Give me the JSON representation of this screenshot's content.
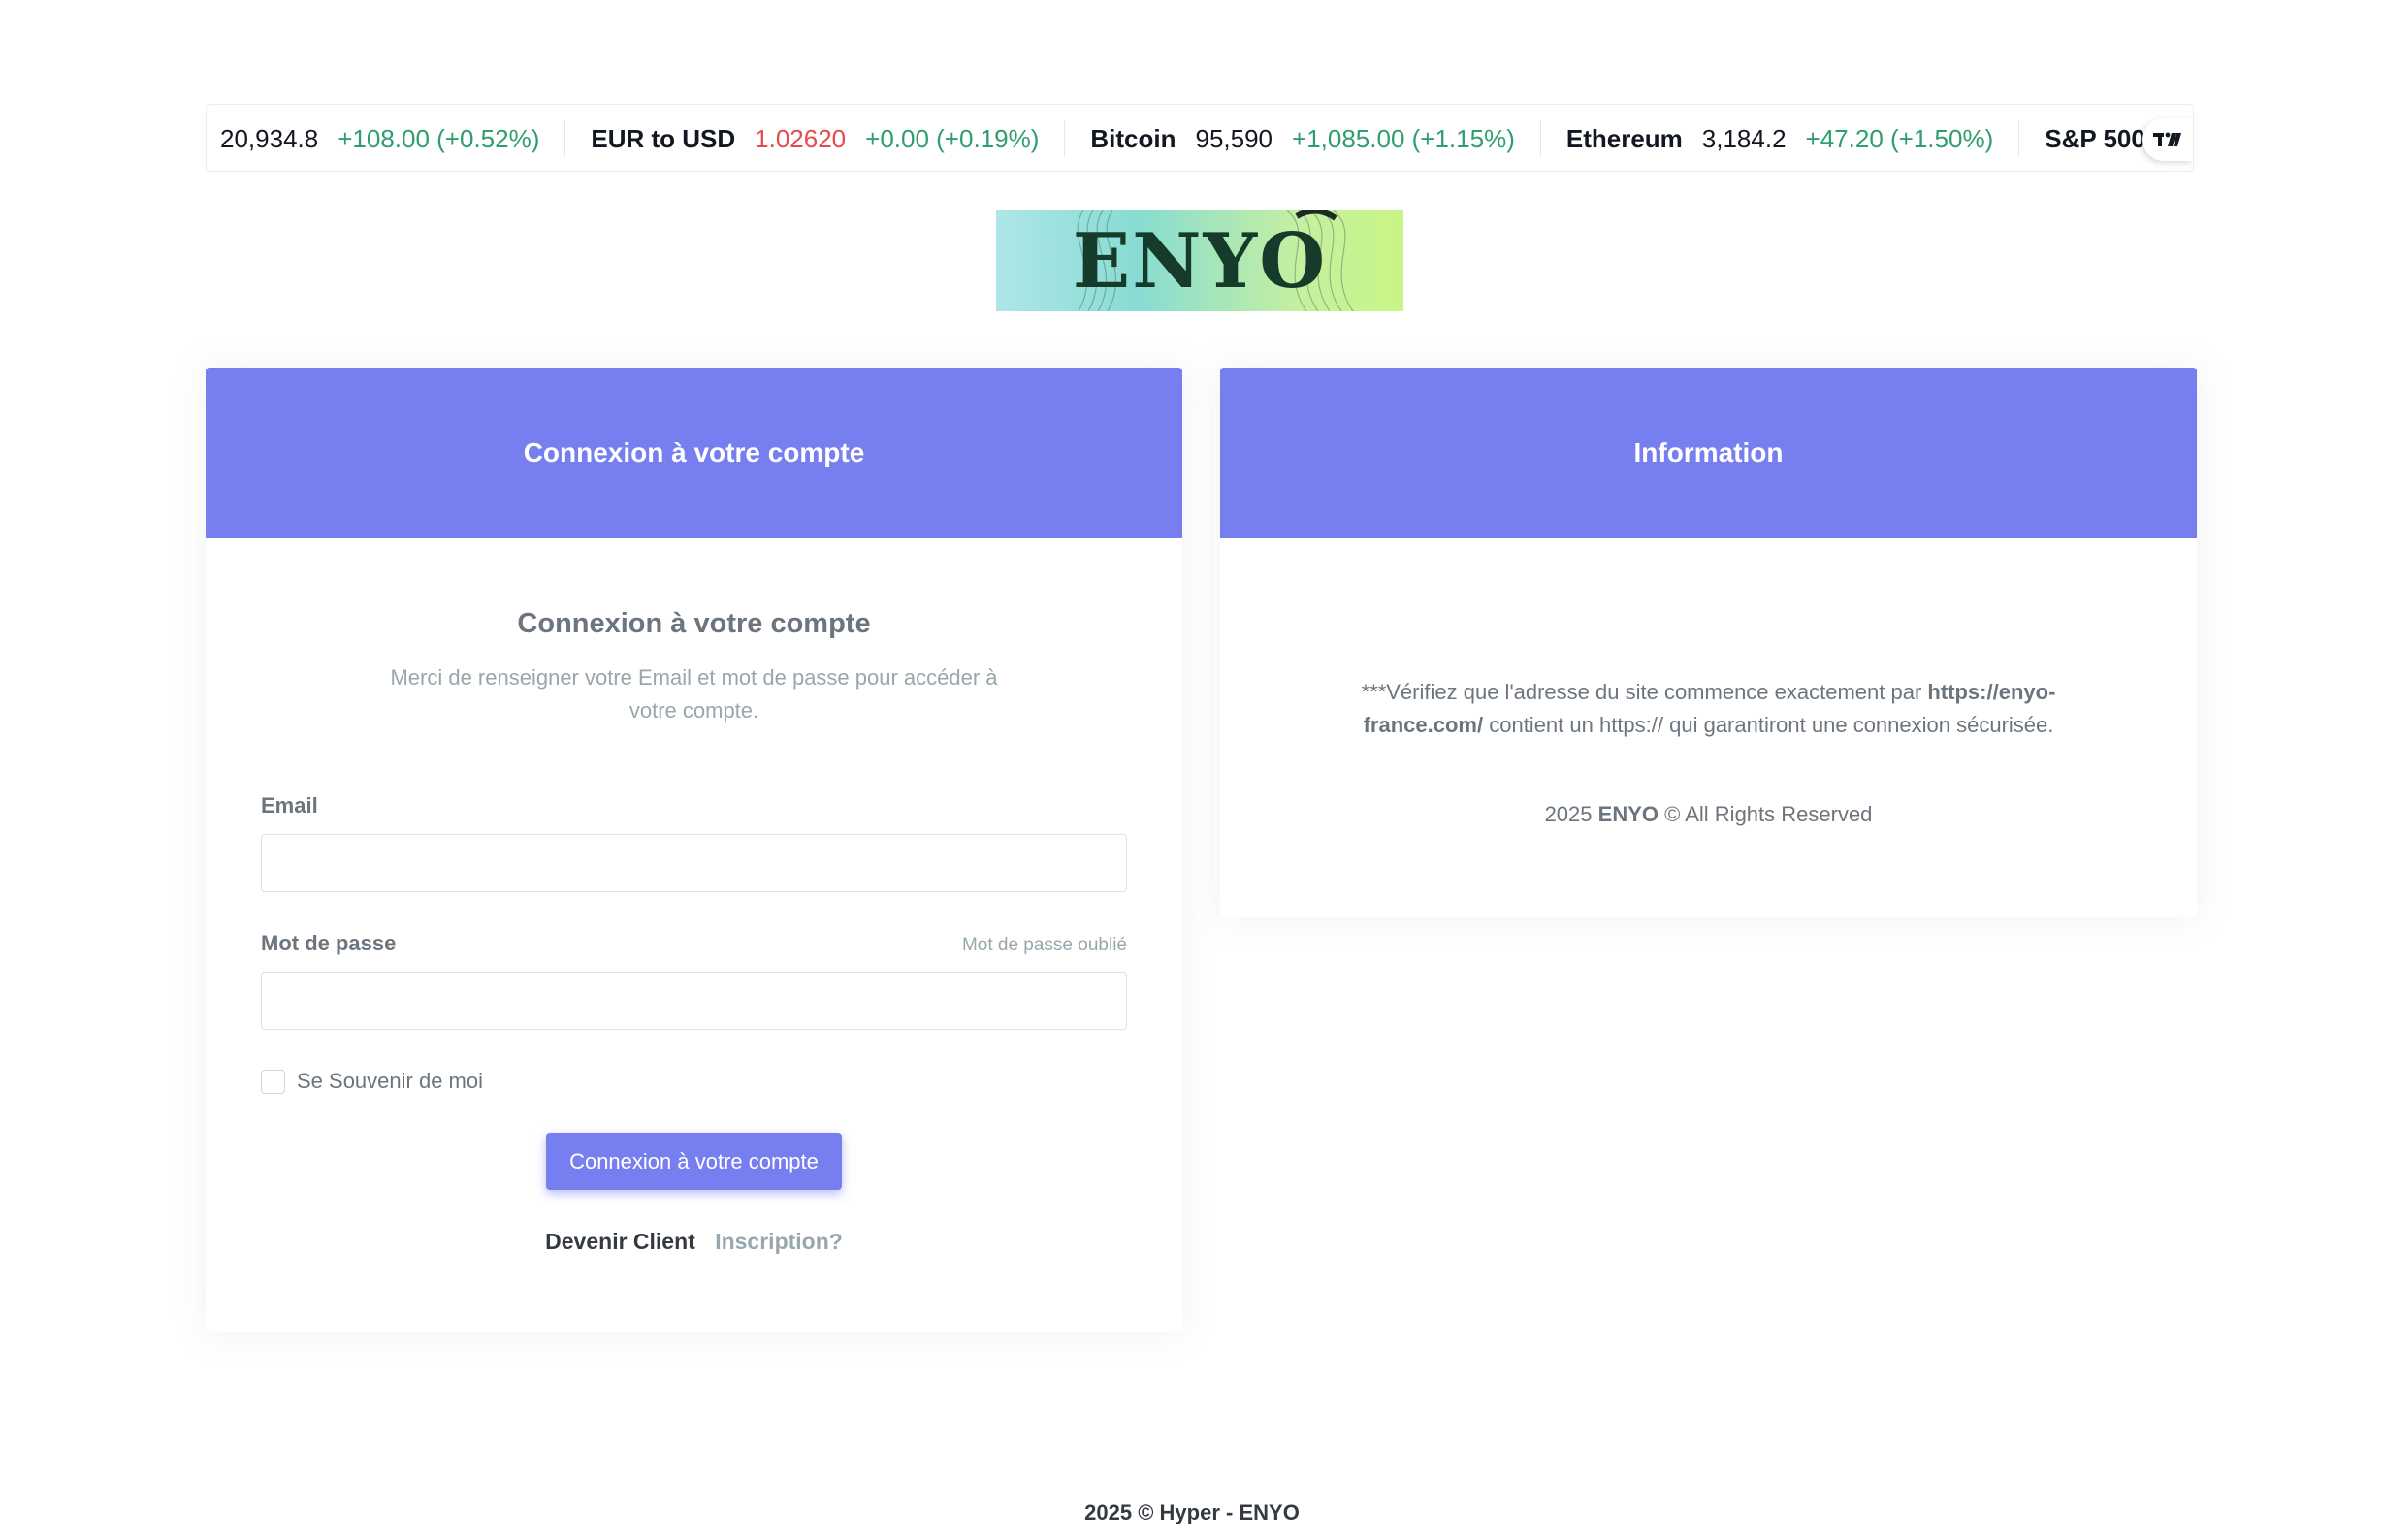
{
  "ticker": {
    "items": [
      {
        "name": "",
        "price": "20,934.8",
        "change": "+108.00 (+0.52%)",
        "price_down": false
      },
      {
        "name": "EUR to USD",
        "price": "1.02620",
        "change": "+0.00 (+0.19%)",
        "price_down": true
      },
      {
        "name": "Bitcoin",
        "price": "95,590",
        "change": "+1,085.00 (+1.15%)",
        "price_down": false
      },
      {
        "name": "Ethereum",
        "price": "3,184.2",
        "change": "+47.20 (+1.50%)",
        "price_down": false
      },
      {
        "name": "S&P 500",
        "price": "",
        "change": "",
        "price_down": false
      }
    ],
    "badge_icon": "tradingview-logo-icon"
  },
  "logo": {
    "text": "ENYO"
  },
  "login_card": {
    "header": "Connexion à votre compte",
    "title": "Connexion à votre compte",
    "subtitle": "Merci de renseigner votre Email et mot de passe pour accéder à votre compte.",
    "email_label": "Email",
    "email_value": "",
    "password_label": "Mot de passe",
    "password_value": "",
    "forgot_label": "Mot de passe oublié",
    "remember_label": "Se Souvenir de moi",
    "submit_label": "Connexion à votre compte",
    "become_client": "Devenir Client",
    "register_link": "Inscription?"
  },
  "info_card": {
    "header": "Information",
    "text_prefix": "***Vérifiez que l'adresse du site commence exactement par ",
    "text_url": "https://enyo-france.com/",
    "text_suffix": " contient un https:// qui garantiront une connexion sécurisée.",
    "copy_year": "2025",
    "copy_brand": "ENYO",
    "copy_rest": "© All Rights Reserved"
  },
  "footer": {
    "text": "2025 © Hyper - ENYO"
  },
  "colors": {
    "primary": "#777ef0",
    "positive": "#2e9e6f",
    "negative": "#e54b4b"
  }
}
